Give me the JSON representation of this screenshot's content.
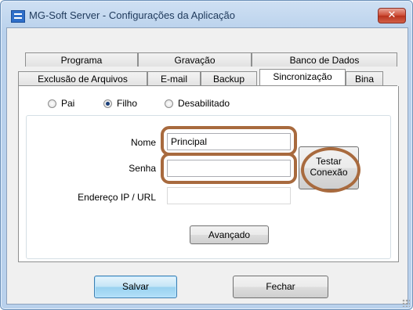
{
  "window": {
    "title": "MG-Soft Server - Configurações da Aplicação",
    "close_glyph": "✕"
  },
  "tabs": {
    "row1": [
      "Programa",
      "Gravação",
      "Banco de Dados"
    ],
    "row2": [
      "Exclusão de Arquivos",
      "E-mail",
      "Backup",
      "Sincronização",
      "Bina"
    ],
    "active": "Sincronização"
  },
  "mode": {
    "options": [
      "Pai",
      "Filho",
      "Desabilitado"
    ],
    "selected": "Filho"
  },
  "form": {
    "nome_label": "Nome",
    "nome_value": "Principal",
    "senha_label": "Senha",
    "senha_value": "",
    "endereco_label": "Endereço IP / URL",
    "endereco_value": ""
  },
  "buttons": {
    "testar_line1": "Testar",
    "testar_line2": "Conexão",
    "avancado": "Avançado",
    "salvar": "Salvar",
    "fechar": "Fechar"
  },
  "colors": {
    "highlight_ring": "#a86a3e",
    "title_text": "#1e395b"
  }
}
